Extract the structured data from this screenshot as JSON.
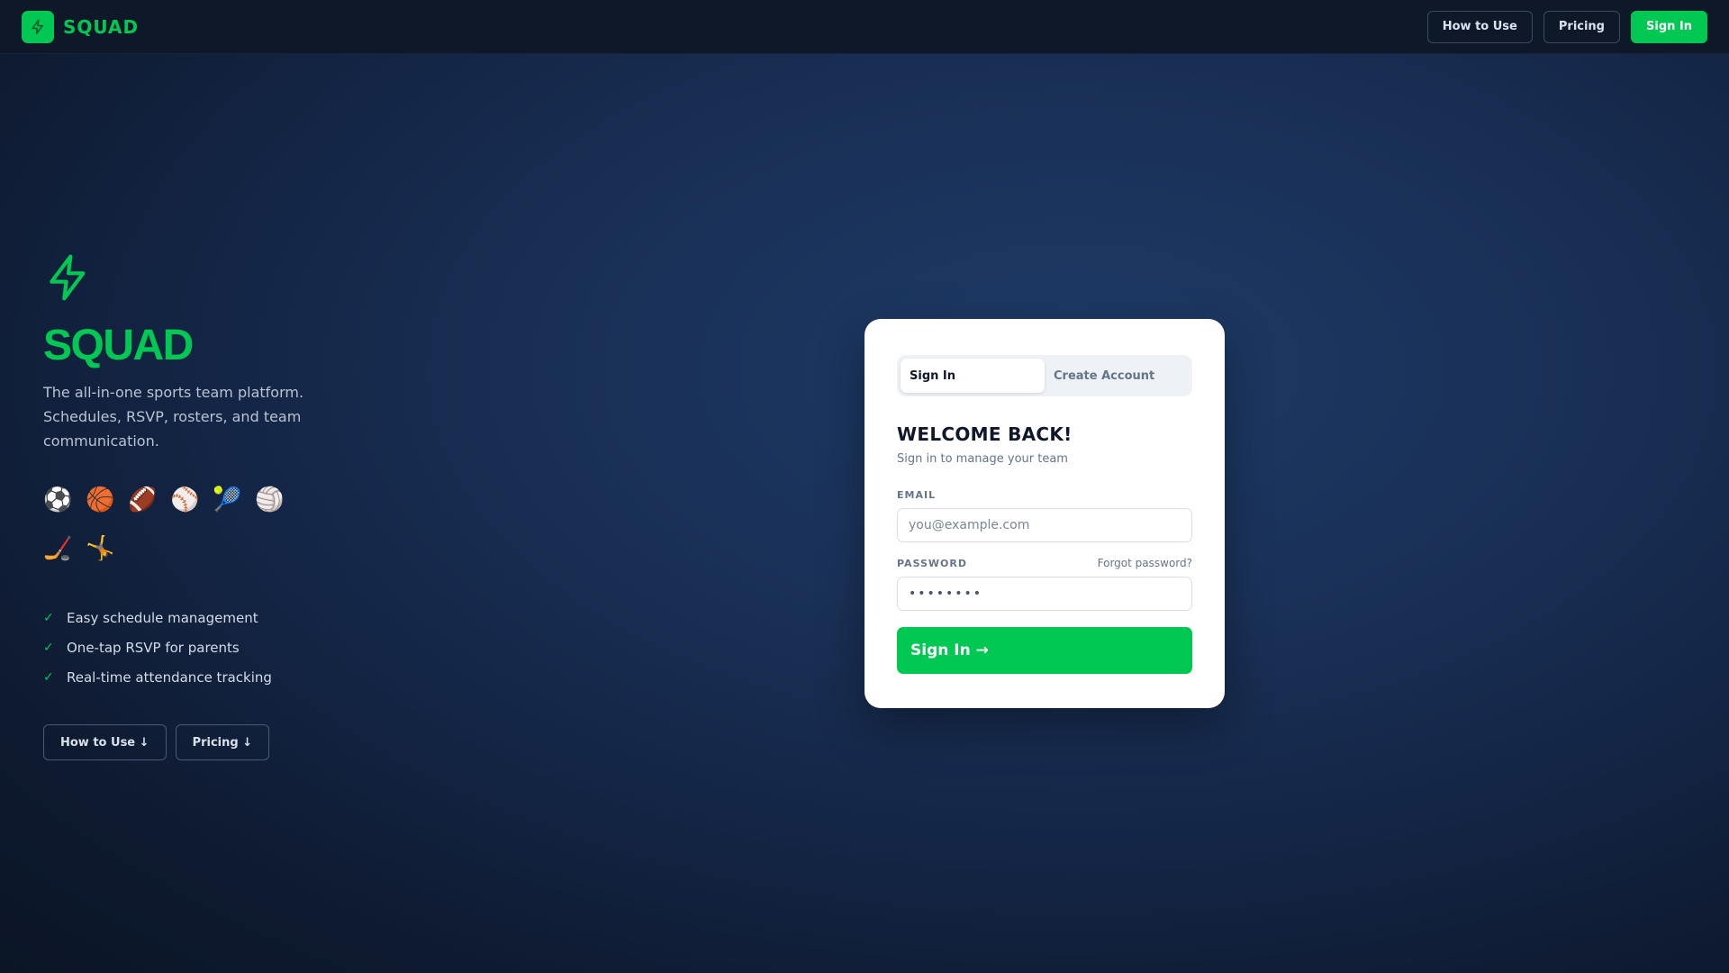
{
  "nav": {
    "brand": "SQUAD",
    "logo_icon": "lightning-bolt-icon",
    "how_to_use": "How to Use",
    "pricing": "Pricing",
    "sign_in": "Sign In"
  },
  "hero": {
    "icon": "lightning-bolt-icon",
    "title": "SQUAD",
    "tagline": "The all-in-one sports team platform. Schedules, RSVP, rosters, and team communication.",
    "sports": [
      {
        "name": "soccer-ball-icon",
        "glyph": "⚽"
      },
      {
        "name": "basketball-icon",
        "glyph": "🏀"
      },
      {
        "name": "football-icon",
        "glyph": "🏈"
      },
      {
        "name": "baseball-icon",
        "glyph": "⚾"
      },
      {
        "name": "tennis-icon",
        "glyph": "🎾"
      },
      {
        "name": "volleyball-icon",
        "glyph": "🏐"
      },
      {
        "name": "hockey-icon",
        "glyph": "🏒"
      },
      {
        "name": "gymnastics-icon",
        "glyph": "🤸"
      }
    ],
    "features": [
      "Easy schedule management",
      "One-tap RSVP for parents",
      "Real-time attendance tracking"
    ],
    "how_to_use": "How to Use ↓",
    "pricing": "Pricing ↓"
  },
  "auth": {
    "tabs": [
      "Sign In",
      "Create Account"
    ],
    "active_tab": "Sign In",
    "title": "WELCOME BACK!",
    "subtitle": "Sign in to manage your team",
    "email_label": "EMAIL",
    "email_placeholder": "you@example.com",
    "password_label": "PASSWORD",
    "forgot": "Forgot password?",
    "password_value": "••••••••",
    "submit": "Sign In →"
  },
  "colors": {
    "accent": "#00c853",
    "nav_bg": "#0e1828",
    "page_bg": "#142647"
  }
}
